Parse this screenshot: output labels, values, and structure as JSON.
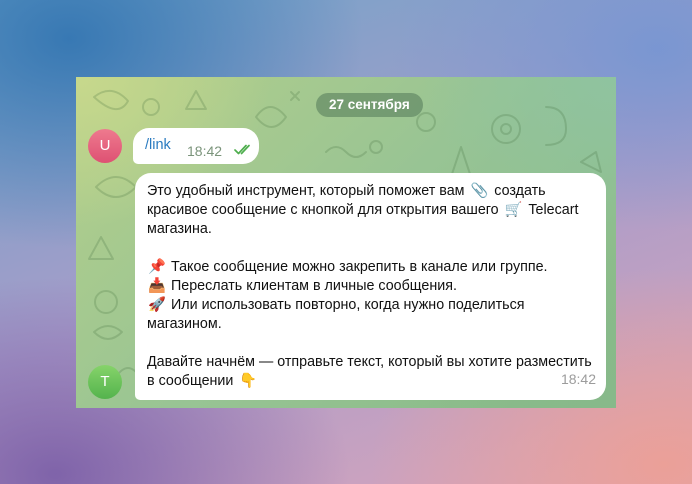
{
  "chat": {
    "date_separator": "27 сентября",
    "messages": [
      {
        "sender_initial": "U",
        "text": "/link",
        "time": "18:42",
        "status": "read"
      },
      {
        "sender_initial": "T",
        "time": "18:42",
        "paragraph_1": {
          "part_1": "Это удобный инструмент, который поможет вам",
          "emoji_1": "📎",
          "part_2": "создать красивое сообщение с кнопкой для открытия вашего",
          "emoji_2": "🛒",
          "part_3": "Telecart магазина."
        },
        "list": [
          {
            "emoji": "📌",
            "text": "Такое сообщение можно закрепить в канале или группе."
          },
          {
            "emoji": "📥",
            "text": "Переслать клиентам в личные сообщения."
          },
          {
            "emoji": "🚀",
            "text": "Или использовать повторно, когда нужно поделиться магазином."
          }
        ],
        "paragraph_3": {
          "text": "Давайте начнём — отправьте текст, который вы хотите разместить в сообщении",
          "emoji": "👇"
        }
      }
    ]
  },
  "colors": {
    "link": "#2a7bc0",
    "read_ticks": "#4fae4e",
    "avatar_u": "#de5173",
    "avatar_t": "#54b34d"
  },
  "icons": {
    "read_status": "double-check-icon"
  }
}
